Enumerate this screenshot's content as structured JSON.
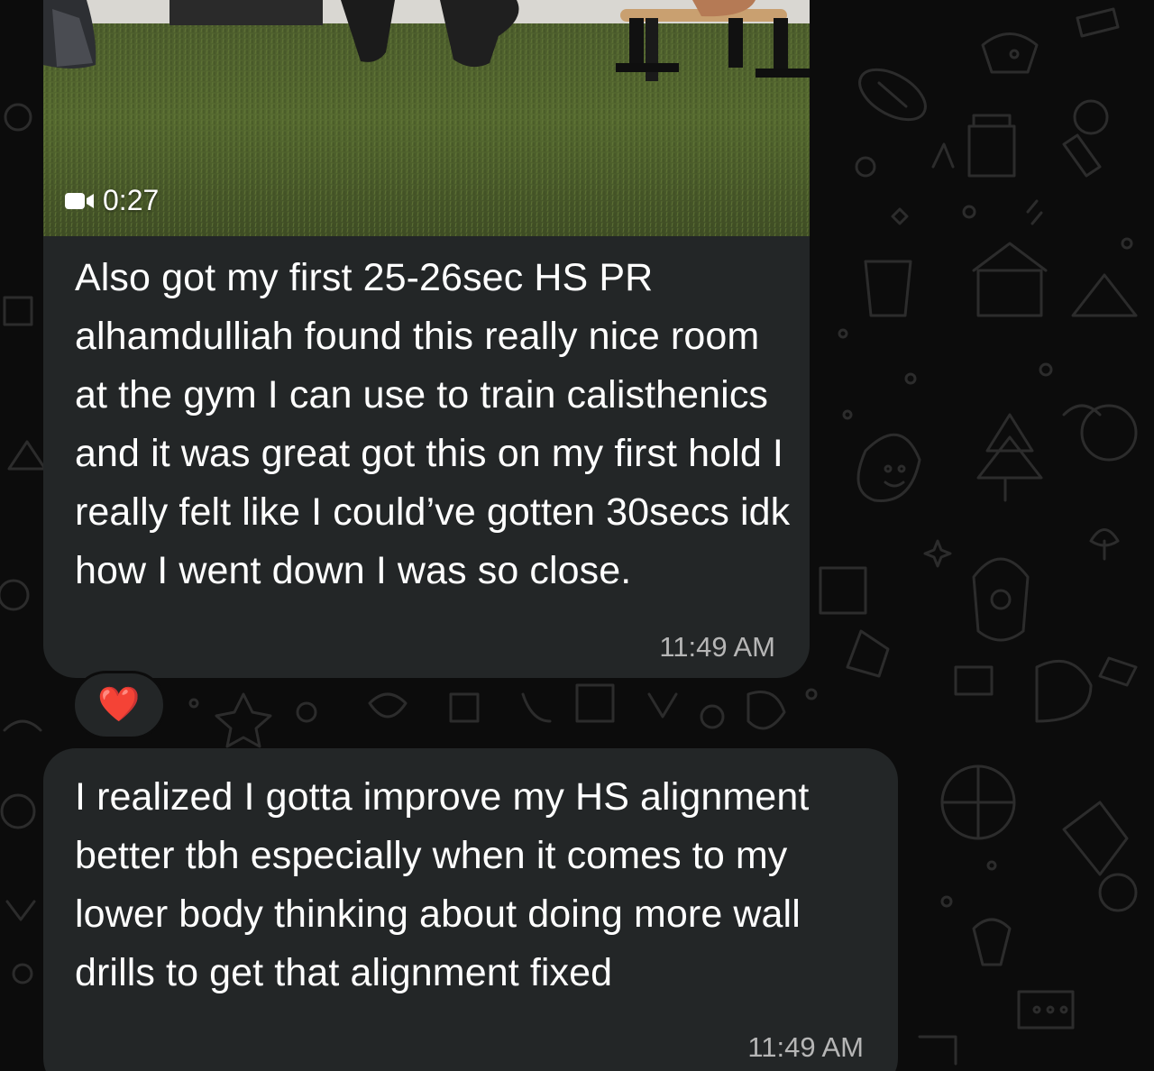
{
  "conversation": {
    "messages": [
      {
        "type": "video",
        "duration": "0:27",
        "caption": "Also got my first 25-26sec HS PR alhamdulliah found this really nice room at the gym I can use to train calisthenics and it was great got this on my first hold I really felt like I could’ve gotten 30secs idk how I went down I was so close.",
        "time": "11:49 AM",
        "reaction": "❤️"
      },
      {
        "type": "text",
        "text": "I realized I gotta improve my HS alignment better tbh especially when it comes to my lower body thinking about doing more wall drills to get that alignment fixed",
        "time": "11:49 AM"
      }
    ]
  },
  "colors": {
    "bubble": "#232627",
    "background": "#0c0c0c",
    "text": "#ffffff",
    "timestamp": "#b6b6b6",
    "heart": "#e0283b"
  }
}
